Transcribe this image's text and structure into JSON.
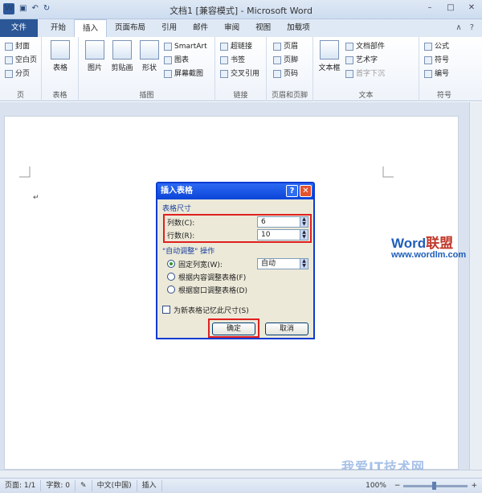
{
  "titlebar": {
    "app_title": "文档1 [兼容模式] - Microsoft Word",
    "logo": "W",
    "undo": "↶",
    "redo": "↻",
    "save": "▣",
    "min": "–",
    "max": "□",
    "close": "✕"
  },
  "tabs": [
    "文件",
    "开始",
    "插入",
    "页面布局",
    "引用",
    "邮件",
    "审阅",
    "视图",
    "加载项"
  ],
  "tab_right": {
    "up": "∧",
    "help": "?"
  },
  "ribbon": {
    "pages": {
      "cover": "封面",
      "blank": "空白页",
      "break": "分页",
      "label": "页"
    },
    "tables": {
      "table": "表格",
      "label": "表格"
    },
    "illustrations": {
      "picture": "图片",
      "clipart": "剪贴画",
      "shapes": "形状",
      "smartart": "SmartArt",
      "chart": "图表",
      "screenshot": "屏幕截图",
      "label": "插图"
    },
    "links": {
      "hyperlink": "超链接",
      "bookmark": "书签",
      "crossref": "交叉引用",
      "label": "链接"
    },
    "header_footer": {
      "header": "页眉",
      "footer": "页脚",
      "pagenum": "页码",
      "label": "页眉和页脚"
    },
    "text": {
      "textbox": "文本框",
      "quickparts": "文档部件",
      "wordart": "艺术字",
      "dropcap": "首字下沉",
      "label": "文本"
    },
    "symbols": {
      "equation": "公式",
      "symbol": "符号",
      "number": "编号",
      "label": "符号"
    }
  },
  "document": {
    "para_mark": "↵"
  },
  "dialog": {
    "title": "插入表格",
    "help": "?",
    "close": "✕",
    "size_section": "表格尺寸",
    "cols_label": "列数(C):",
    "cols_value": "6",
    "rows_label": "行数(R):",
    "rows_value": "10",
    "autofit_section": "\"自动调整\" 操作",
    "fixed_label": "固定列宽(W):",
    "fixed_value": "自动",
    "fit_content": "根据内容调整表格(F)",
    "fit_window": "根据窗口调整表格(D)",
    "remember": "为新表格记忆此尺寸(S)",
    "ok": "确定",
    "cancel": "取消"
  },
  "watermark": {
    "word": "Word",
    "lianmeng": "联盟",
    "url": "www.wordlm.com",
    "site": "我爱IT技术网"
  },
  "status": {
    "page": "页面: 1/1",
    "words": "字数: 0",
    "lang": "中文(中国)",
    "mode": "插入",
    "zoom": "100%",
    "minus": "−",
    "plus": "+"
  },
  "colors": {
    "accent": "#2b5797",
    "highlight": "#e02020",
    "dialog_title": "#0a44d8"
  }
}
